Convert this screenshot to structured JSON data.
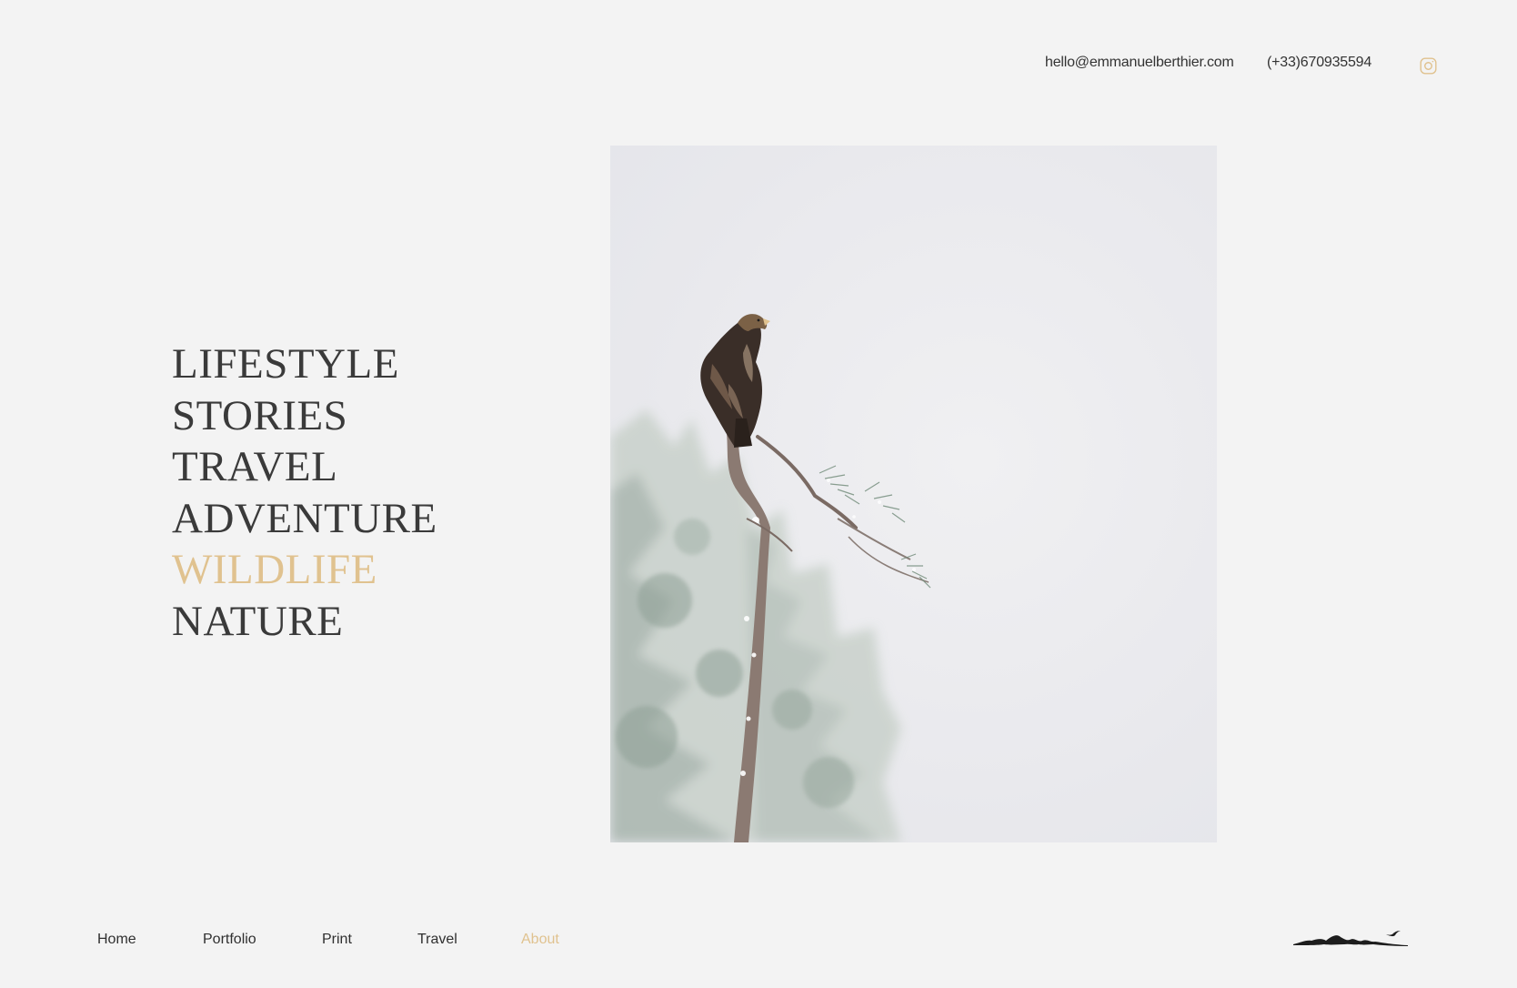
{
  "header": {
    "email": "hello@emmanuelberthier.com",
    "phone": "(+33)670935594",
    "instagram_icon": "instagram-icon"
  },
  "categories": [
    {
      "label": "LIFESTYLE",
      "active": false
    },
    {
      "label": "STORIES",
      "active": false
    },
    {
      "label": "TRAVEL",
      "active": false
    },
    {
      "label": "ADVENTURE",
      "active": false
    },
    {
      "label": "WILDLIFE",
      "active": true
    },
    {
      "label": "NATURE",
      "active": false
    }
  ],
  "photo": {
    "subject": "eagle-on-snowy-tree"
  },
  "nav": [
    {
      "label": "Home",
      "active": false
    },
    {
      "label": "Portfolio",
      "active": false
    },
    {
      "label": "Print",
      "active": false
    },
    {
      "label": "Travel",
      "active": false
    },
    {
      "label": "About",
      "active": true
    }
  ],
  "logo": {
    "icon": "mountain-bird-logo"
  },
  "colors": {
    "background": "#f3f3f3",
    "accent": "#e0c28f",
    "text": "#3a3a3a"
  }
}
